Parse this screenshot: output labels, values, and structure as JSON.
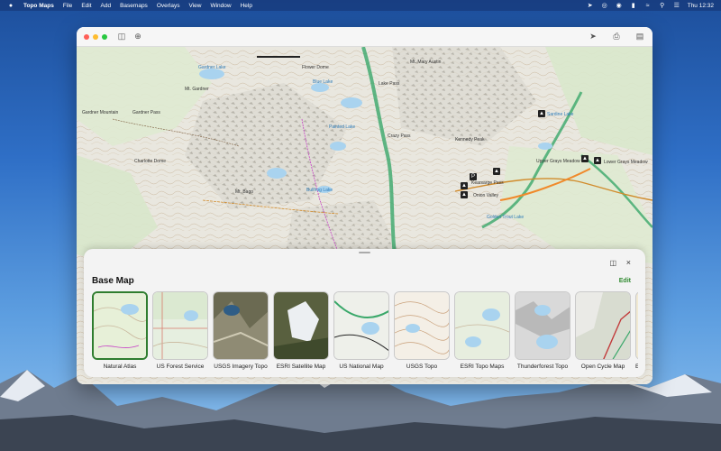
{
  "menubar": {
    "app_name": "Topo Maps",
    "menus": [
      "File",
      "Edit",
      "Add",
      "Basemaps",
      "Overlays",
      "View",
      "Window",
      "Help"
    ],
    "clock": "Thu 12:32"
  },
  "map": {
    "labels": [
      {
        "text": "Gardner Lake",
        "cls": "water"
      },
      {
        "text": "Mt. Gardner",
        "cls": ""
      },
      {
        "text": "Gardner Mountain",
        "cls": ""
      },
      {
        "text": "Gardner Pass",
        "cls": ""
      },
      {
        "text": "Mt. Mary Austin",
        "cls": ""
      },
      {
        "text": "Blue Lake",
        "cls": "water"
      },
      {
        "text": "Lake Pass",
        "cls": ""
      },
      {
        "text": "Flower Dome",
        "cls": ""
      },
      {
        "text": "Painted Lake",
        "cls": "water"
      },
      {
        "text": "Crazy Pass",
        "cls": ""
      },
      {
        "text": "Charlotte Dome",
        "cls": ""
      },
      {
        "text": "Kennedy Peak",
        "cls": ""
      },
      {
        "text": "Sardine Lake",
        "cls": "water"
      },
      {
        "text": "Upper Grays Meadow",
        "cls": ""
      },
      {
        "text": "Lower Grays Meadow",
        "cls": ""
      },
      {
        "text": "Onion Valley",
        "cls": ""
      },
      {
        "text": "Kearsarge Pass",
        "cls": ""
      },
      {
        "text": "Mt. Bago",
        "cls": ""
      },
      {
        "text": "Bullfrog Lake",
        "cls": "water"
      },
      {
        "text": "Golden Trout Lake",
        "cls": "water"
      }
    ]
  },
  "panel": {
    "title": "Base Map",
    "edit_label": "Edit",
    "close_glyph": "×",
    "sidebar_glyph": "◫",
    "tiles": [
      {
        "label": "Natural Atlas",
        "selected": true
      },
      {
        "label": "US Forest Service",
        "selected": false
      },
      {
        "label": "USGS Imagery Topo",
        "selected": false
      },
      {
        "label": "ESRI Satellite Map",
        "selected": false
      },
      {
        "label": "US National Map",
        "selected": false
      },
      {
        "label": "USGS Topo",
        "selected": false
      },
      {
        "label": "ESRI Topo Maps",
        "selected": false
      },
      {
        "label": "Thunderforest Topo",
        "selected": false
      },
      {
        "label": "Open Cycle Map",
        "selected": false
      },
      {
        "label": "E",
        "selected": false
      }
    ]
  },
  "colors": {
    "accent": "#2f8a2f",
    "map_bg": "#e9e7df",
    "river": "#3aa86a"
  }
}
